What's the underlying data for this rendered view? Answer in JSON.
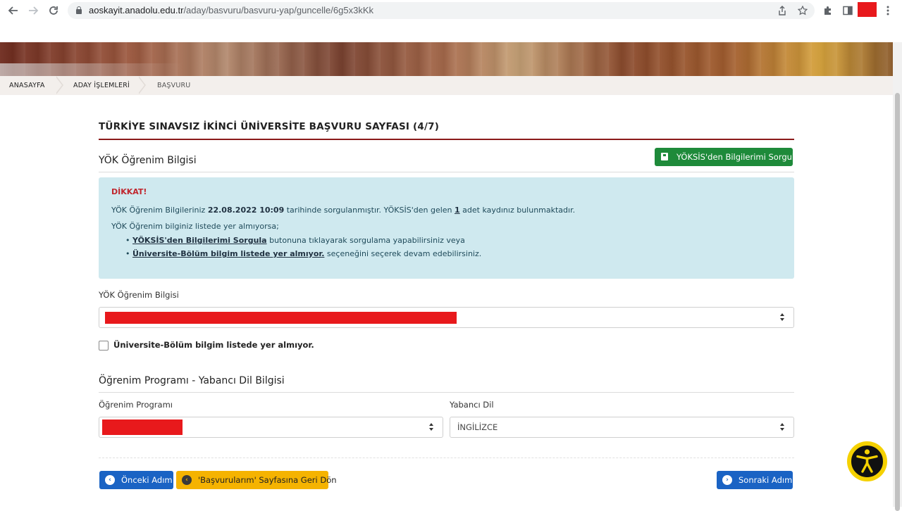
{
  "browser": {
    "url_host": "aoskayit.anadolu.edu.tr",
    "url_path": "/aday/basvuru/basvuru-yap/guncelle/6g5x3kKk",
    "icons": [
      "back-arrow-icon",
      "forward-arrow-icon",
      "reload-icon",
      "lock-icon",
      "share-icon",
      "star-icon",
      "extensions-icon",
      "side-panel-icon",
      "menu-icon"
    ]
  },
  "breadcrumb": {
    "items": [
      {
        "label": "ANASAYFA"
      },
      {
        "label": "ADAY İŞLEMLERİ"
      },
      {
        "label": "BAŞVURU"
      }
    ]
  },
  "page": {
    "title": "TÜRKİYE SINAVSIZ İKİNCİ ÜNİVERSİTE BAŞVURU SAYFASI (4/7)"
  },
  "yok_section": {
    "title": "YÖK Öğrenim Bilgisi",
    "query_button": "YÖKSİS'den Bilgilerimi Sorgula"
  },
  "alert": {
    "heading": "DİKKAT!",
    "line1_pre": "YÖK Öğrenim Bilgileriniz ",
    "line1_date": "22.08.2022 10:09",
    "line1_mid": " tarihinde sorgulanmıştır. YÖKSİS'den gelen ",
    "line1_count": "1",
    "line1_post": " adet kaydınız bulunmaktadır.",
    "line2": "YÖK Öğrenim bilginiz listede yer almıyorsa;",
    "bullet1_link": "YÖKSİS'den Bilgilerimi Sorgula",
    "bullet1_text": " butonuna tıklayarak sorgulama yapabilirsiniz veya",
    "bullet2_link": "Üniversite-Bölüm bilgim listede yer almıyor.",
    "bullet2_text": " seçeneğini seçerek devam edebilirsiniz."
  },
  "yok_field": {
    "label": "YÖK Öğrenim Bilgisi"
  },
  "checkbox": {
    "label": "Üniversite-Bölüm bilgim listede yer almıyor.",
    "checked": false
  },
  "program_section": {
    "title": "Öğrenim Programı - Yabancı Dil Bilgisi",
    "program_label": "Öğrenim Programı",
    "language_label": "Yabancı Dil",
    "language_value": "İNGİLİZCE"
  },
  "actions": {
    "prev": "Önceki Adım",
    "back": "'Başvurularım' Sayfasına Geri Dön",
    "next": "Sonraki Adım"
  },
  "colors": {
    "accent_rule": "#8b1a1a",
    "green": "#1e8a3a",
    "blue": "#1a63c4",
    "yellow": "#f5b301",
    "alert_bg": "#cfe9ef",
    "redaction": "#e8191c"
  }
}
